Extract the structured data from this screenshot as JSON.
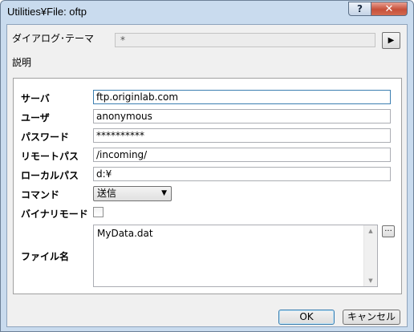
{
  "window": {
    "title": "Utilities¥File: oftp",
    "help_label": "?",
    "close_label": "✕"
  },
  "theme": {
    "label": "ダイアログ･テーマ",
    "value": "*",
    "arrow_icon": "▶"
  },
  "description_label": "説明",
  "form": {
    "server": {
      "label": "サーバ",
      "value": "ftp.originlab.com"
    },
    "user": {
      "label": "ユーザ",
      "value": "anonymous"
    },
    "password": {
      "label": "パスワード",
      "value": "**********"
    },
    "remote_path": {
      "label": "リモートパス",
      "value": "/incoming/"
    },
    "local_path": {
      "label": "ローカルパス",
      "value": "d:¥"
    },
    "command": {
      "label": "コマンド",
      "value": "送信"
    },
    "binary_mode": {
      "label": "バイナリモード",
      "checked": false
    },
    "file_name": {
      "label": "ファイル名",
      "value": "MyData.dat",
      "browse_label": "..."
    }
  },
  "buttons": {
    "ok": "OK",
    "cancel": "キャンセル"
  }
}
